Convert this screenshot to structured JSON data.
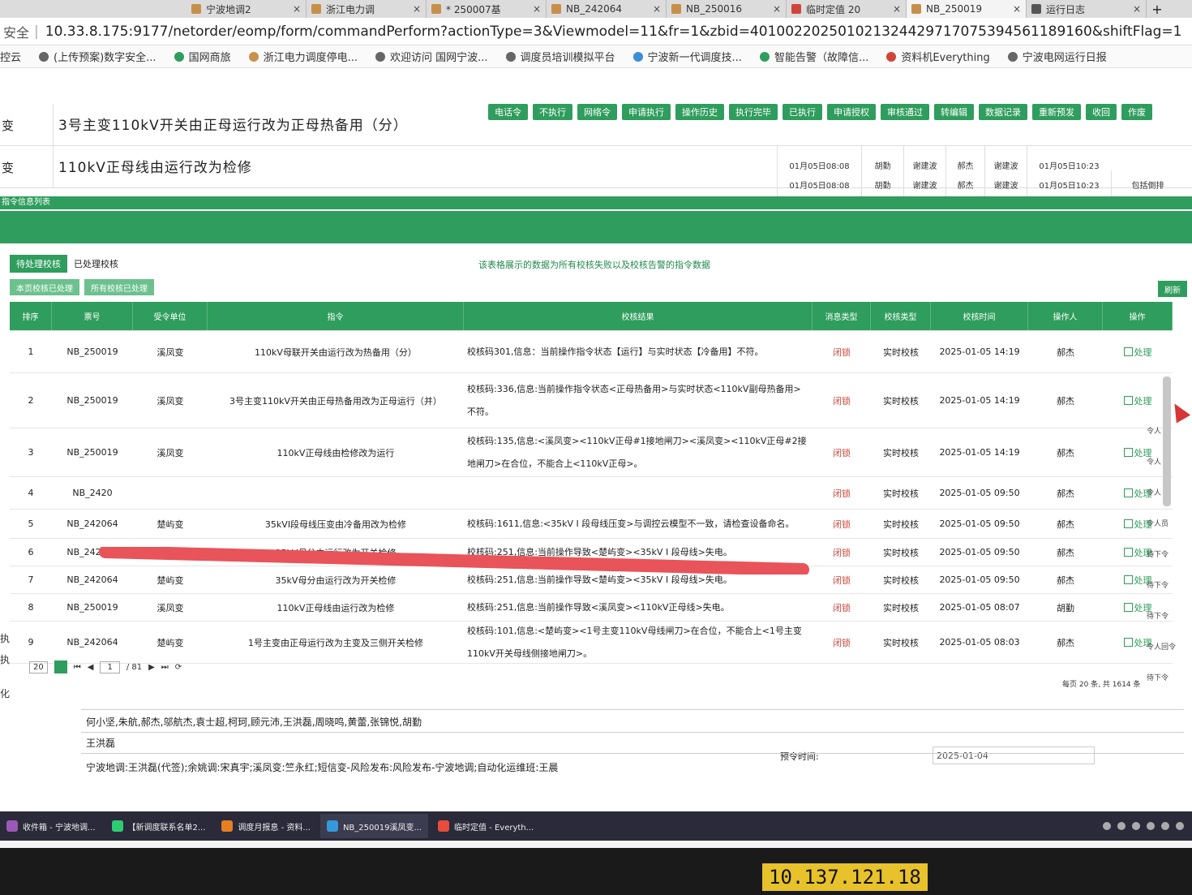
{
  "browser": {
    "tabs": [
      {
        "label": "宁波地调2",
        "close": "×"
      },
      {
        "label": "浙江电力调",
        "close": "×"
      },
      {
        "label": "* 250007基",
        "close": "×"
      },
      {
        "label": "NB_242064",
        "close": "×"
      },
      {
        "label": "NB_250016",
        "close": "×"
      },
      {
        "label": "临时定值 20",
        "close": "×"
      },
      {
        "label": "NB_250019",
        "close": "×"
      },
      {
        "label": "运行日志",
        "close": "×"
      }
    ],
    "new_tab": "+",
    "security": "安全",
    "url": "10.33.8.175:9177/netorder/eomp/form/commandPerform?actionType=3&Viewmodel=11&fr=1&zbid=40100220250102132442971707539456118916​0&shiftFlag=1",
    "bookmarks": [
      {
        "label": "控云"
      },
      {
        "label": "(上传预案)数字安全..."
      },
      {
        "label": "国网商旅"
      },
      {
        "label": "浙江电力调度停电..."
      },
      {
        "label": "欢迎访问 国网宁波..."
      },
      {
        "label": "调度员培训模拟平台"
      },
      {
        "label": "宁波新一代调度技..."
      },
      {
        "label": "智能告警（故障信..."
      },
      {
        "label": "资料机Everything"
      },
      {
        "label": "宁波电网运行日报"
      }
    ]
  },
  "commands": [
    {
      "station": "变",
      "title": "3号主变110kV开关由正母运行改为正母热备用（分）"
    },
    {
      "station": "变",
      "title": "110kV正母线由运行改为检修",
      "time1": "01月05日08:08",
      "person1": "胡勤",
      "person2": "谢建波",
      "person3": "郝杰",
      "person4": "谢建波",
      "time2": "01月05日10:23"
    }
  ],
  "extra_row": {
    "time1": "01月05日08:08",
    "person1": "胡勤",
    "person2": "谢建波",
    "person3": "郝杰",
    "person4": "谢建波",
    "time2": "01月05日10:23",
    "tag": "包括倒排"
  },
  "toolbar": [
    "电话令",
    "不执行",
    "网络令",
    "申请执行",
    "操作历史",
    "执行完毕",
    "已执行",
    "申请授权",
    "审核通过",
    "转编辑",
    "数据记录",
    "重新预发",
    "收回",
    "作废"
  ],
  "strip_label": "指令信息列表",
  "check_panel": {
    "tabs": [
      "待处理校核",
      "已处理校核"
    ],
    "notice": "该表格展示的数据为所有校核失败以及校核告警的指令数据",
    "filters": [
      "本页校核已处理",
      "所有校核已处理"
    ],
    "refresh": "刷新",
    "columns": [
      "排序",
      "票号",
      "受令单位",
      "指令",
      "校核结果",
      "消息类型",
      "校核类型",
      "校核时间",
      "操作人",
      "操作"
    ],
    "rows": [
      {
        "seq": "1",
        "ticket": "NB_250019",
        "unit": "溪凤变",
        "cmd": "110kV母联开关由运行改为热备用（分）",
        "result": "校核码301,信息：当前操作指令状态【运行】与实时状态【冷备用】不符。",
        "msg": "闭锁",
        "type": "实时校核",
        "time": "2025-01-05 14:19",
        "op": "郝杰",
        "act": "处理"
      },
      {
        "seq": "2",
        "ticket": "NB_250019",
        "unit": "溪凤变",
        "cmd": "3号主变110kV开关由正母热备用改为正母运行（并）",
        "result": "校核码:336,信息:当前操作指令状态<正母热备用>与实时状态<110kV副母热备用>不符。",
        "msg": "闭锁",
        "type": "实时校核",
        "time": "2025-01-05 14:19",
        "op": "郝杰",
        "act": "处理"
      },
      {
        "seq": "3",
        "ticket": "NB_250019",
        "unit": "溪凤变",
        "cmd": "110kV正母线由检修改为运行",
        "result": "校核码:135,信息:<溪凤变><110kV正母#1接地闸刀><溪凤变><110kV正母#2接地闸刀>在合位，不能合上<110kV正母>。",
        "msg": "闭锁",
        "type": "实时校核",
        "time": "2025-01-05 14:19",
        "op": "郝杰",
        "act": "处理"
      },
      {
        "seq": "4",
        "ticket": "NB_2420",
        "unit": "",
        "cmd": "",
        "result": "",
        "msg": "闭锁",
        "type": "实时校核",
        "time": "2025-01-05 09:50",
        "op": "郝杰",
        "act": "处理"
      },
      {
        "seq": "5",
        "ticket": "NB_242064",
        "unit": "楚屿变",
        "cmd": "35kVI段母线压变由冷备用改为检修",
        "result": "校核码:1611,信息:<35kV I 段母线压变>与调控云模型不一致，请检查设备命名。",
        "msg": "闭锁",
        "type": "实时校核",
        "time": "2025-01-05 09:50",
        "op": "郝杰",
        "act": "处理"
      },
      {
        "seq": "6",
        "ticket": "NB_242064",
        "unit": "楚屿变",
        "cmd": "35kV母分由运行改为开关检修",
        "result": "校核码:251,信息:当前操作导致<楚屿变><35kV I 段母线>失电。",
        "msg": "闭锁",
        "type": "实时校核",
        "time": "2025-01-05 09:50",
        "op": "郝杰",
        "act": "处理"
      },
      {
        "seq": "7",
        "ticket": "NB_242064",
        "unit": "楚屿变",
        "cmd": "35kV母分由运行改为开关检修",
        "result": "校核码:251,信息:当前操作导致<楚屿变><35kV I 段母线>失电。",
        "msg": "闭锁",
        "type": "实时校核",
        "time": "2025-01-05 09:50",
        "op": "郝杰",
        "act": "处理"
      },
      {
        "seq": "8",
        "ticket": "NB_250019",
        "unit": "溪凤变",
        "cmd": "110kV正母线由运行改为检修",
        "result": "校核码:251,信息:当前操作导致<溪凤变><110kV正母线>失电。",
        "msg": "闭锁",
        "type": "实时校核",
        "time": "2025-01-05 08:07",
        "op": "胡勤",
        "act": "处理"
      },
      {
        "seq": "9",
        "ticket": "NB_242064",
        "unit": "楚屿变",
        "cmd": "1号主变由正母运行改为主变及三侧开关检修",
        "result": "校核码:101,信息:<楚屿变><1号主变110kV母线闸刀>在合位，不能合上<1号主变110kV开关母线侧接地闸刀>。",
        "msg": "闭锁",
        "type": "实时校核",
        "time": "2025-01-05 08:03",
        "op": "郝杰",
        "act": "处理"
      }
    ],
    "pager": {
      "size": "20",
      "page": "1",
      "of": "/ 81",
      "total": "每页 20 条, 共 1614 条"
    },
    "side_actions": [
      "令人",
      "令人",
      "令人",
      "令人员",
      "待下令",
      "待下令",
      "待下令",
      "令人回令",
      "待下令"
    ]
  },
  "form": {
    "left_labels": [
      "执",
      "执",
      "化"
    ],
    "participants": "何小坚,朱航,郝杰,邬航杰,袁士超,柯珂,顾元沛,王洪磊,周晓鸣,黄蕾,张锦悦,胡勤",
    "recorder": "王洪磊",
    "notify": "宁波地调:王洪磊(代签);余姚调:宋真宇;溪凤变:竺永红;短信变-风险发布:风险发布-宁波地调;自动化运维班:王晨",
    "preorder_label": "预令时间:",
    "preorder_value": "2025-01-04"
  },
  "taskbar": [
    {
      "label": "收件箱 - 宁波地调...",
      "color": "#9b59b6"
    },
    {
      "label": "【新调度联系名单2...",
      "color": "#2ecc71"
    },
    {
      "label": "调度月报息 - 资料...",
      "color": "#e67e22"
    },
    {
      "label": "NB_250019溪凤变...",
      "color": "#3498db"
    },
    {
      "label": "临时定值 - Everyth...",
      "color": "#e74c3c"
    }
  ],
  "ip_label": "10.137.121.18"
}
